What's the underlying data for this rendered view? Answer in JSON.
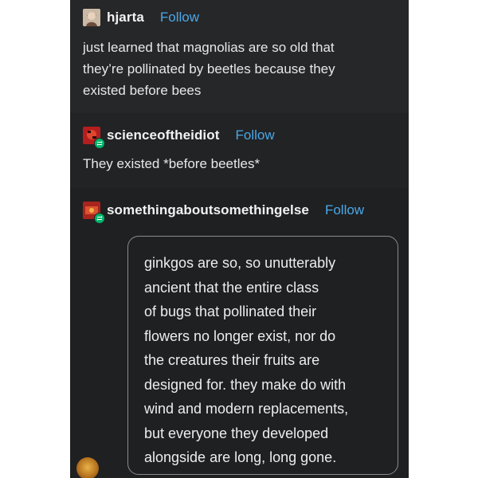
{
  "posts": [
    {
      "username": "hjarta",
      "follow_label": "Follow",
      "avatar_icon": "portrait-avatar-icon",
      "lines": [
        "just learned that magnolias are so old that",
        "they’re pollinated by beetles because they",
        "existed before bees"
      ]
    },
    {
      "username": "scienceoftheidiot",
      "follow_label": "Follow",
      "avatar_icon": "red-avatar-icon",
      "reblog_icon": "reblog-icon",
      "lines": [
        "They existed *before beetles*"
      ]
    },
    {
      "username": "somethingaboutsomethingelse",
      "follow_label": "Follow",
      "avatar_icon": "red-avatar-icon",
      "reblog_icon": "reblog-icon",
      "quote_lines": [
        "ginkgos are so, so unutterably",
        "ancient that the entire class",
        "of bugs that pollinated their",
        "flowers no longer exist, nor do",
        "the creatures their fruits are",
        "designed for. they make do with",
        "wind and modern replacements,",
        "but everyone they developed",
        "alongside are long, long gone."
      ]
    }
  ],
  "colors": {
    "background": "#232426",
    "text": "#ececec",
    "follow": "#4aa8e8",
    "reblog_badge": "#00b56a",
    "quote_border": "#8a8b8e"
  }
}
